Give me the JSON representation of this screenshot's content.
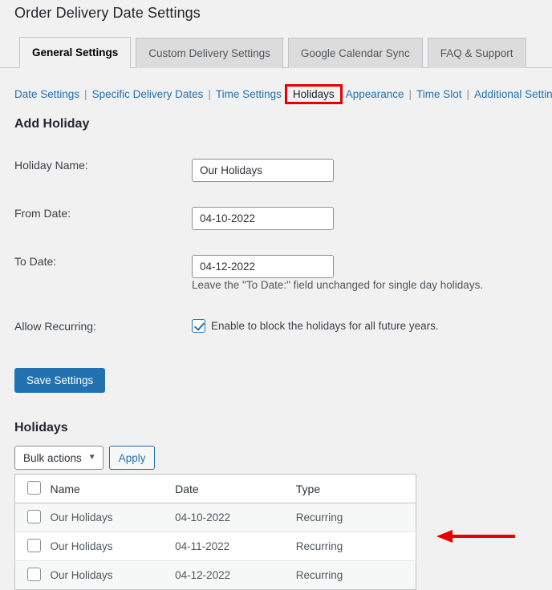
{
  "page": {
    "title": "Order Delivery Date Settings"
  },
  "tabs": [
    {
      "label": "General Settings",
      "active": true
    },
    {
      "label": "Custom Delivery Settings",
      "active": false
    },
    {
      "label": "Google Calendar Sync",
      "active": false
    },
    {
      "label": "FAQ & Support",
      "active": false
    }
  ],
  "subnav": {
    "items": [
      {
        "label": "Date Settings",
        "current": false
      },
      {
        "label": "Specific Delivery Dates",
        "current": false
      },
      {
        "label": "Time Settings",
        "current": false
      },
      {
        "label": "Holidays",
        "current": true
      },
      {
        "label": "Appearance",
        "current": false
      },
      {
        "label": "Time Slot",
        "current": false
      },
      {
        "label": "Additional Settings",
        "current": false
      }
    ],
    "separator": "|",
    "highlight_color": "#e60000"
  },
  "add_holiday": {
    "heading": "Add Holiday",
    "fields": {
      "holiday_name": {
        "label": "Holiday Name:",
        "value": "Our Holidays",
        "placeholder": ""
      },
      "from_date": {
        "label": "From Date:",
        "value": "04-10-2022",
        "placeholder": ""
      },
      "to_date": {
        "label": "To Date:",
        "value": "04-12-2022",
        "placeholder": "",
        "hint": "Leave the \"To Date:\" field unchanged for single day holidays."
      },
      "allow_recurring": {
        "label": "Allow Recurring:",
        "checkbox_label": "Enable to block the holidays for all future years.",
        "checked": true
      }
    },
    "save_label": "Save Settings",
    "save_color": "#2271b1"
  },
  "holidays_list": {
    "heading": "Holidays",
    "bulk_actions_label": "Bulk actions",
    "apply_label": "Apply",
    "columns": [
      "Name",
      "Date",
      "Type"
    ],
    "rows": [
      {
        "name": "Our Holidays",
        "date": "04-10-2022",
        "type": "Recurring"
      },
      {
        "name": "Our Holidays",
        "date": "04-11-2022",
        "type": "Recurring"
      },
      {
        "name": "Our Holidays",
        "date": "04-12-2022",
        "type": "Recurring"
      }
    ]
  },
  "annotation": {
    "arrow_color": "#e60000",
    "direction": "left"
  }
}
